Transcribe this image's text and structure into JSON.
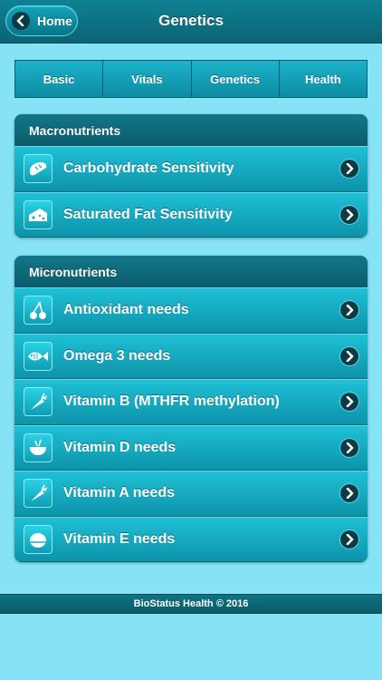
{
  "header": {
    "home_label": "Home",
    "title": "Genetics",
    "back_icon": "chevron-left-icon"
  },
  "tabs": [
    {
      "label": "Basic"
    },
    {
      "label": "Vitals"
    },
    {
      "label": "Genetics"
    },
    {
      "label": "Health"
    }
  ],
  "macronutrients": {
    "title": "Macronutrients",
    "items": [
      {
        "label": "Carbohydrate Sensitivity",
        "icon": "bread-icon"
      },
      {
        "label": "Saturated Fat Sensitivity",
        "icon": "cheese-icon"
      }
    ]
  },
  "micronutrients": {
    "title": "Micronutrients",
    "items": [
      {
        "label": "Antioxidant needs",
        "icon": "cherries-icon"
      },
      {
        "label": "Omega 3 needs",
        "icon": "fish-icon"
      },
      {
        "label": "Vitamin B (MTHFR methylation)",
        "icon": "carrot-icon"
      },
      {
        "label": "Vitamin D needs",
        "icon": "bowl-icon"
      },
      {
        "label": "Vitamin A needs",
        "icon": "carrot-icon"
      },
      {
        "label": "Vitamin E needs",
        "icon": "egg-icon"
      }
    ]
  },
  "footer": {
    "text": "BioStatus Health © 2016"
  },
  "colors": {
    "background": "#86e3f6",
    "bar": "#0a6474",
    "row": "#15a9c1"
  }
}
